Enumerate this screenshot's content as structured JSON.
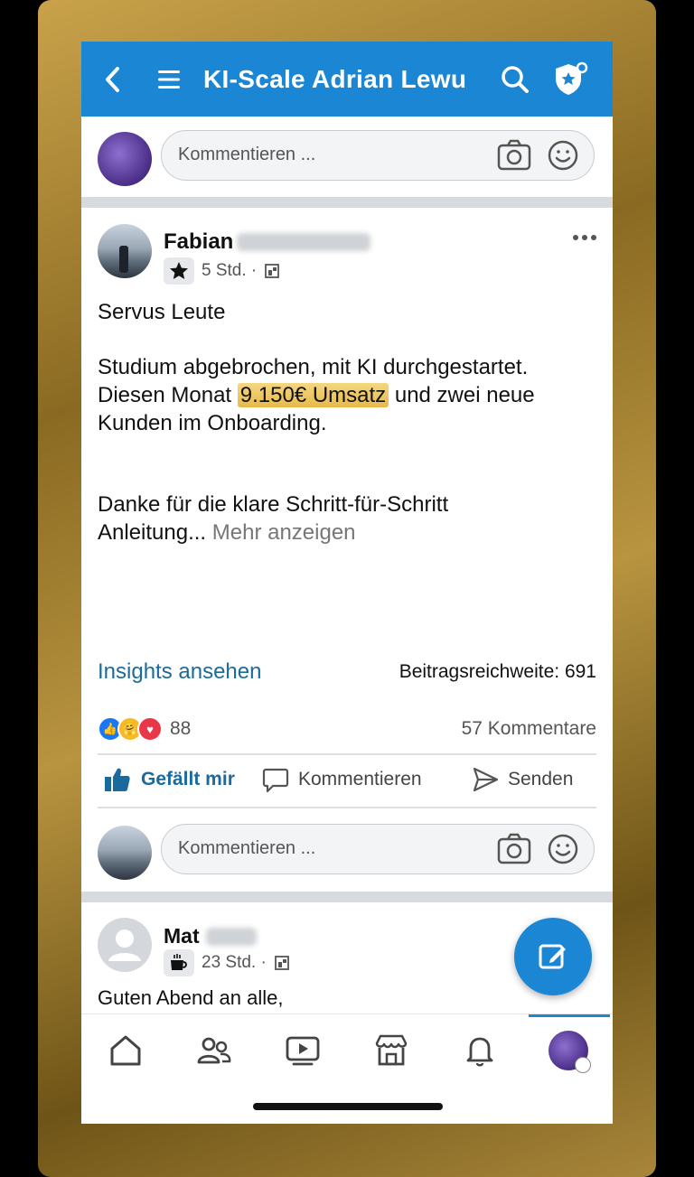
{
  "header": {
    "title": "KI-Scale Adrian Lewu"
  },
  "composer": {
    "placeholder": "Kommentieren ..."
  },
  "post1": {
    "author_first": "Fabian",
    "time": "5 Std. ·",
    "greeting": "Servus Leute",
    "line1": "Studium abgebrochen, mit KI durchgestartet.",
    "line2_pre": "Diesen Monat ",
    "line2_highlight": "9.150€ Umsatz",
    "line2_post": " und zwei neue",
    "line3": "Kunden im Onboarding.",
    "line4": "Danke für die klare Schritt-für-Schritt",
    "line5": "Anleitung...",
    "more": "Mehr anzeigen",
    "insights": "Insights ansehen",
    "reach": "Beitragsreichweite: 691",
    "reaction_count": "88",
    "comment_count": "57 Kommentare",
    "actions": {
      "like": "Gefällt mir",
      "comment": "Kommentieren",
      "send": "Senden"
    },
    "comment_placeholder": "Kommentieren ..."
  },
  "post2": {
    "author_first": "Mat",
    "time": "23 Std. ·",
    "text": "Guten Abend an alle,"
  },
  "colors": {
    "brand": "#1a86d4",
    "link": "#1b6a9e",
    "highlight": "#e7b94a"
  }
}
